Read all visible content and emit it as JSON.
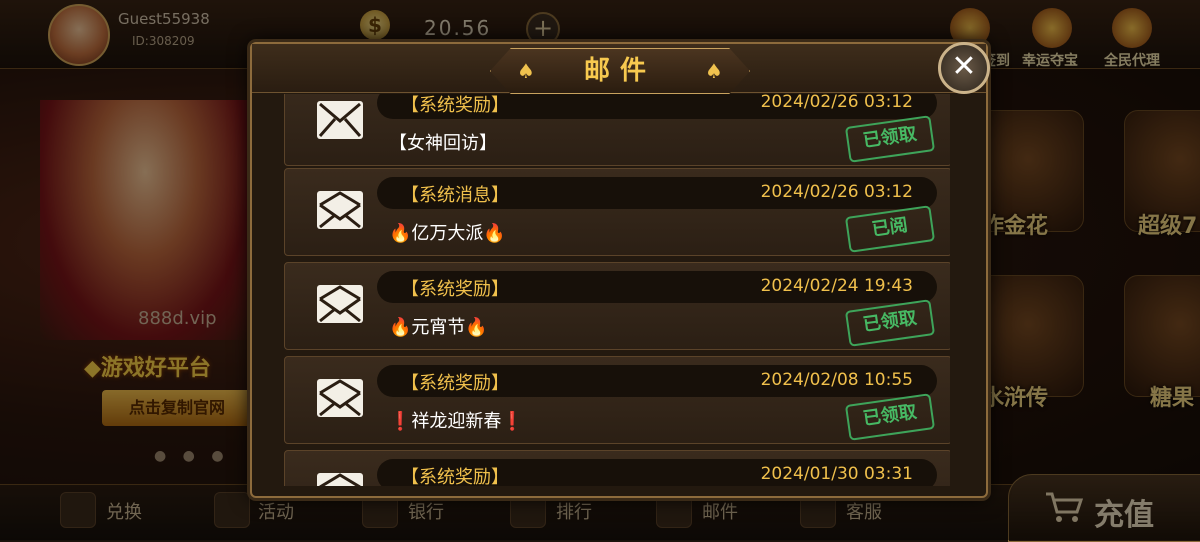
{
  "user": {
    "name": "Guest55938",
    "id": "ID:308209"
  },
  "wallet": {
    "balance": "20.56",
    "coin_icon": "$",
    "add_icon": "+"
  },
  "top_actions": [
    {
      "label": "签到"
    },
    {
      "label": "幸运夺宝"
    },
    {
      "label": "全民代理"
    }
  ],
  "promo": {
    "site": "888d.vip",
    "slogan": "◆游戏好平台",
    "copy_button": "点击复制官网",
    "carousel_dots": "● ● ●"
  },
  "games": [
    {
      "label": "炸金花"
    },
    {
      "label": "超级7"
    },
    {
      "label": "水浒传"
    },
    {
      "label": "糖果"
    }
  ],
  "bottom_nav": [
    {
      "label": "兑换",
      "icon": "exchange-icon"
    },
    {
      "label": "活动",
      "icon": "gift-icon"
    },
    {
      "label": "银行",
      "icon": "safe-icon"
    },
    {
      "label": "排行",
      "icon": "trophy-icon"
    },
    {
      "label": "邮件",
      "icon": "mail-icon"
    },
    {
      "label": "客服",
      "icon": "headset-icon"
    }
  ],
  "recharge": {
    "label": "充值"
  },
  "modal": {
    "title": "邮件",
    "close_label": "✕",
    "mails": [
      {
        "type": "【系统奖励】",
        "date": "2024/02/26 03:12",
        "subject": "【女神回访】",
        "status": "已领取"
      },
      {
        "type": "【系统消息】",
        "date": "2024/02/26 03:12",
        "subject": "🔥亿万大派🔥",
        "status": "已阅"
      },
      {
        "type": "【系统奖励】",
        "date": "2024/02/24 19:43",
        "subject": "🔥元宵节🔥",
        "status": "已领取"
      },
      {
        "type": "【系统奖励】",
        "date": "2024/02/08 10:55",
        "subject": "❗祥龙迎新春❗",
        "status": "已领取"
      },
      {
        "type": "【系统奖励】",
        "date": "2024/01/30 03:31",
        "subject": "",
        "status": ""
      }
    ]
  },
  "colors": {
    "accent_gold": "#f0c04c",
    "stamp_green": "#47b964",
    "panel": "#23190f"
  }
}
